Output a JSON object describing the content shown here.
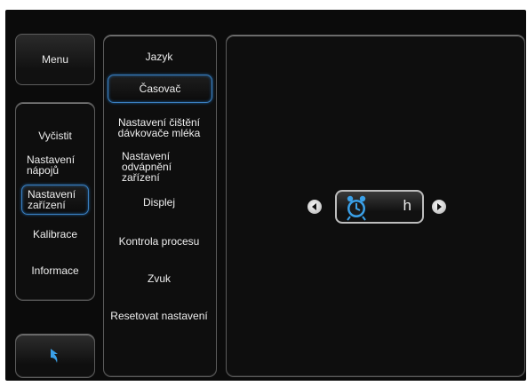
{
  "menu_label": "Menu",
  "categories": [
    {
      "label": "Vyčistit"
    },
    {
      "label": "Nastavení nápojů"
    },
    {
      "label": "Nastavení zařízení"
    },
    {
      "label": "Kalibrace"
    },
    {
      "label": "Informace"
    }
  ],
  "submenu": [
    {
      "label": "Jazyk"
    },
    {
      "label": "Časovač"
    },
    {
      "label": "Nastavení čištění dávkovače mléka"
    },
    {
      "label": "Nastavení odvápnění zařízení"
    },
    {
      "label": "Displej"
    },
    {
      "label": "Kontrola procesu"
    },
    {
      "label": "Zvuk"
    },
    {
      "label": "Resetovat nastavení"
    }
  ],
  "timer": {
    "unit": "h",
    "icon": "alarm-clock-icon"
  },
  "icons": {
    "back": "back-arrow-icon",
    "prev": "chevron-left-icon",
    "next": "chevron-right-icon"
  },
  "colors": {
    "accent": "#3a7fc0",
    "icon_blue": "#3aa0e8",
    "background": "#0b0b0b"
  }
}
